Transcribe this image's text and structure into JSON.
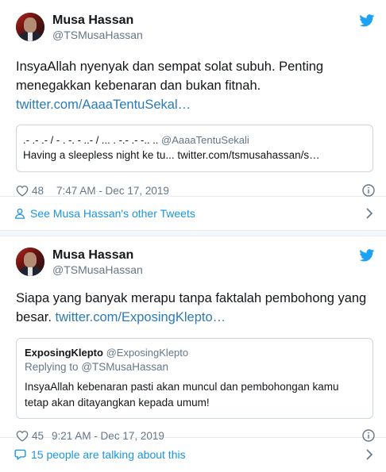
{
  "tweet1": {
    "name": "Musa Hassan",
    "handle": "@TSMusaHassan",
    "text_line1": "InsyaAllah nyenyak dan sempat solat subuh. Penting",
    "text_line2": "menegakkan kebenaran dan bukan fitnah.",
    "link": "twitter.com/AaaaTentuSekal…",
    "quote": {
      "name": ".- .- .- / - . -. - ..- / ... . -.- .- -.. ..",
      "handle": "@AaaaTentuSekali",
      "text": "Having a sleepless night ke tu... twitter.com/tsmusahassan/s…"
    },
    "likes": "48",
    "timestamp": "7:47 AM - Dec 17, 2019",
    "footer": "See Musa Hassan's other Tweets"
  },
  "tweet2": {
    "name": "Musa Hassan",
    "handle": "@TSMusaHassan",
    "text_line1": "Siapa yang banyak merapu tanpa faktalah pembohong yang",
    "text_line2": "besar.",
    "link": "twitter.com/ExposingKlepto…",
    "quote": {
      "name": "ExposingKlepto",
      "handle": "@ExposingKlepto",
      "reply_prefix": "Replying to",
      "reply_handle": "@TSMusaHassan",
      "text_line1": "InsyaAllah kebenaran pasti akan muncul dan pembohongan kamu",
      "text_line2": "tetap akan ditayangkan kepada umum!"
    },
    "likes": "45",
    "timestamp": "9:21 AM - Dec 17, 2019",
    "footer": "15 people are talking about this"
  },
  "colors": {
    "link": "#2b7bb9",
    "accent": "#1b95e0",
    "muted": "#657786",
    "bird": "#1da1f2"
  },
  "icons": [
    "twitter-bird-icon",
    "heart-icon",
    "info-icon",
    "person-icon",
    "chevron-right-icon",
    "speech-bubble-icon"
  ]
}
